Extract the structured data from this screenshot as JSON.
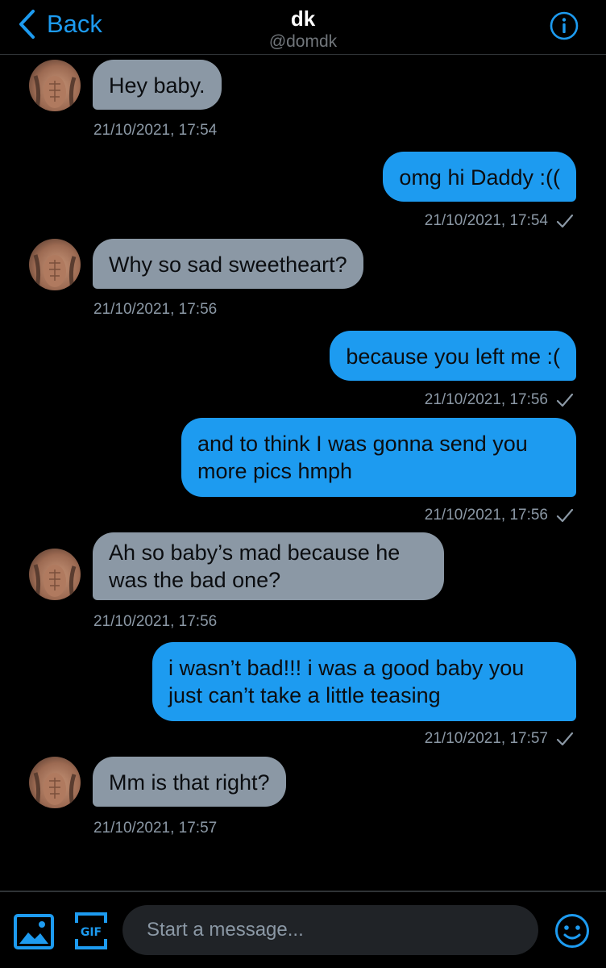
{
  "header": {
    "back_label": "Back",
    "title": "dk",
    "handle": "@domdk"
  },
  "messages": [
    {
      "from": "them",
      "text": "Hey baby.",
      "time": "21/10/2021, 17:54"
    },
    {
      "from": "me",
      "text": "omg hi Daddy :((",
      "time": "21/10/2021, 17:54"
    },
    {
      "from": "them",
      "text": "Why so sad sweetheart?",
      "time": "21/10/2021, 17:56"
    },
    {
      "from": "me",
      "text": "because you left me :(",
      "time": "21/10/2021, 17:56"
    },
    {
      "from": "me",
      "text": "and to think I was gonna send you more pics hmph",
      "time": "21/10/2021, 17:56"
    },
    {
      "from": "them",
      "text": "Ah so baby’s mad because he was the bad one?",
      "time": "21/10/2021, 17:56"
    },
    {
      "from": "me",
      "text": "i wasn’t bad!!! i was a good baby you just can’t take a little teasing",
      "time": "21/10/2021, 17:57"
    },
    {
      "from": "them",
      "text": "Mm is that right?",
      "time": "21/10/2021, 17:57"
    }
  ],
  "composer": {
    "placeholder": "Start a message...",
    "gif_label": "GIF"
  },
  "icons": {
    "back": "chevron-left-icon",
    "info": "info-icon",
    "read_receipt": "checkmark-icon",
    "media": "image-icon",
    "gif": "gif-icon",
    "emoji": "emoji-icon"
  },
  "colors": {
    "accent": "#1d9bf0",
    "incoming_bubble": "#8b98a5",
    "background": "#000000"
  }
}
